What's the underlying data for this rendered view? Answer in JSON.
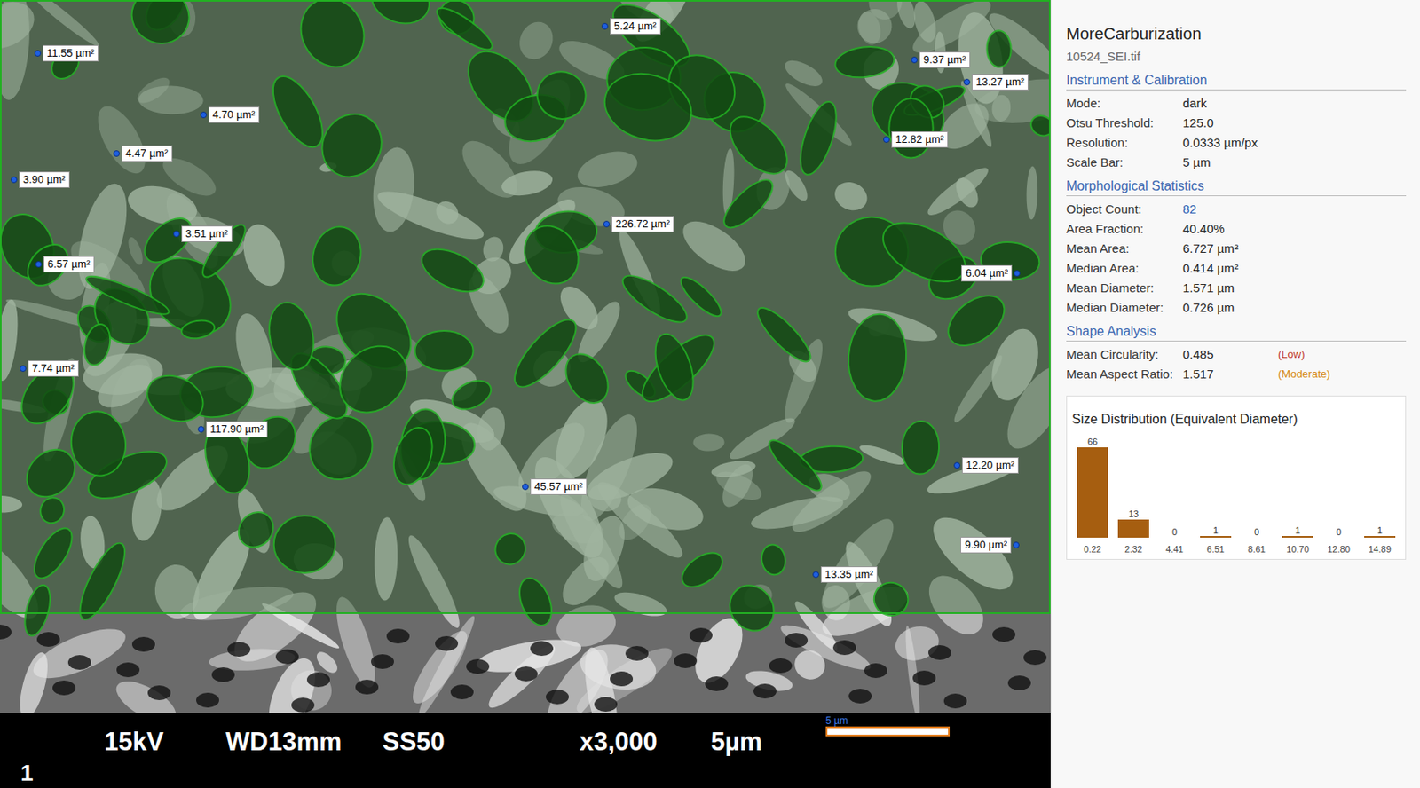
{
  "image": {
    "annotations": [
      {
        "label": "11.55 µm²"
      },
      {
        "label": "5.24 µm²"
      },
      {
        "label": "9.37 µm²"
      },
      {
        "label": "13.27 µm²"
      },
      {
        "label": "4.70 µm²"
      },
      {
        "label": "4.47 µm²"
      },
      {
        "label": "12.82 µm²"
      },
      {
        "label": "3.90 µm²"
      },
      {
        "label": "226.72 µm²"
      },
      {
        "label": "3.51 µm²"
      },
      {
        "label": "6.57 µm²"
      },
      {
        "label": "6.04 µm²"
      },
      {
        "label": "7.74 µm²"
      },
      {
        "label": "117.90 µm²"
      },
      {
        "label": "12.20 µm²"
      },
      {
        "label": "45.57 µm²"
      },
      {
        "label": "9.90 µm²"
      },
      {
        "label": "13.35 µm²"
      }
    ],
    "scale_bar": {
      "label": "5 µm"
    },
    "databar": [
      "15kV",
      "WD13mm",
      "SS50",
      "x3,000",
      "5µm"
    ],
    "panel_number": "1"
  },
  "panel": {
    "title": "MoreCarburization",
    "file": "10524_SEI.tif",
    "sections": [
      {
        "heading": "Instrument & Calibration",
        "rows": [
          {
            "key": "Mode:",
            "value": "dark",
            "kind": "plain"
          },
          {
            "key": "Otsu Threshold:",
            "value": "125.0",
            "kind": "plain"
          },
          {
            "key": "Resolution:",
            "value": "0.0333 µm/px",
            "kind": "plain"
          },
          {
            "key": "Scale Bar:",
            "value": "5 µm",
            "kind": "plain"
          }
        ]
      },
      {
        "heading": "Morphological Statistics",
        "rows": [
          {
            "key": "Object Count:",
            "value": "82",
            "kind": "link"
          },
          {
            "key": "Area Fraction:",
            "value": "40.40%",
            "kind": "plain"
          },
          {
            "key": "Mean Area:",
            "value": "6.727 µm²",
            "kind": "plain"
          },
          {
            "key": "Median Area:",
            "value": "0.414 µm²",
            "kind": "plain"
          },
          {
            "key": "Mean Diameter:",
            "value": "1.571 µm",
            "kind": "plain"
          },
          {
            "key": "Median Diameter:",
            "value": "0.726 µm",
            "kind": "plain"
          }
        ]
      },
      {
        "heading": "Shape Analysis",
        "rows": [
          {
            "key": "Mean Circularity:",
            "value": "0.485",
            "kind": "tagged",
            "tag": "(Low)",
            "color": "#c0392b"
          },
          {
            "key": "Mean Aspect Ratio:",
            "value": "1.517",
            "kind": "tagged",
            "tag": "(Moderate)",
            "color": "#d68910"
          }
        ]
      }
    ],
    "chart": {
      "title": "Size Distribution (Equivalent Diameter)",
      "counts": [
        66,
        13,
        0,
        1,
        0,
        1,
        0,
        1
      ],
      "count_labels": [
        "66",
        "13",
        "0",
        "1",
        "0",
        "1",
        "0",
        "1"
      ],
      "ticks": [
        "0.22",
        "2.32",
        "4.41",
        "6.51",
        "8.61",
        "10.70",
        "12.80",
        "14.89"
      ]
    }
  }
}
